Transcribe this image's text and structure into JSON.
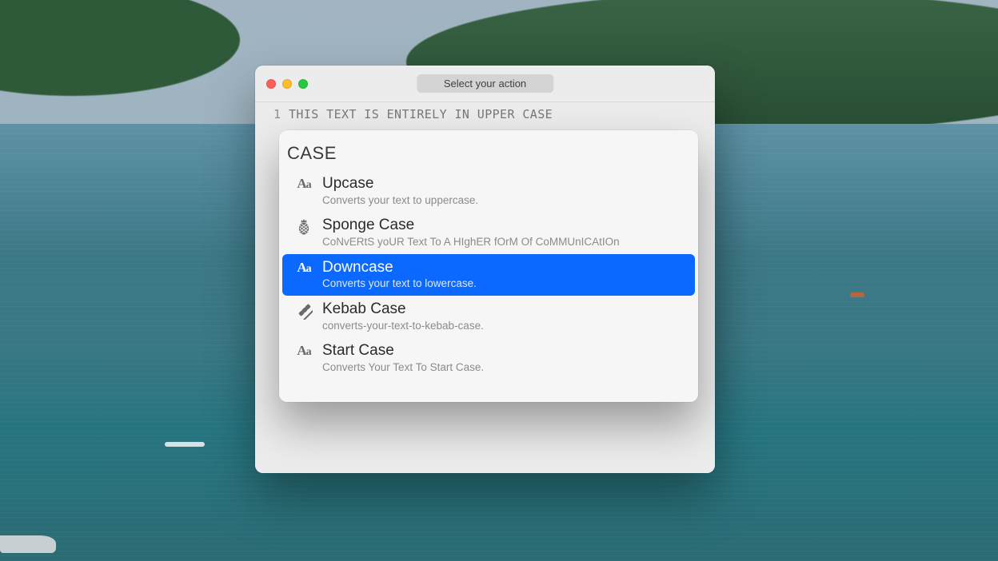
{
  "titlebar": {
    "search_placeholder": "Select your action"
  },
  "editor": {
    "line_number": "1",
    "text": "THIS TEXT IS ENTIRELY IN UPPER CASE"
  },
  "dropdown": {
    "header": "CASE",
    "options": [
      {
        "icon": "aa",
        "title": "Upcase",
        "desc": "Converts your text to uppercase.",
        "selected": false
      },
      {
        "icon": "pineapple",
        "title": "Sponge Case",
        "desc": "CoNvERtS yoUR Text To A HIghER fOrM Of CoMMUnICAtIOn",
        "selected": false
      },
      {
        "icon": "aa",
        "title": "Downcase",
        "desc": "Converts your text to lowercase.",
        "selected": true
      },
      {
        "icon": "kebab",
        "title": "Kebab Case",
        "desc": "converts-your-text-to-kebab-case.",
        "selected": false
      },
      {
        "icon": "aa",
        "title": "Start Case",
        "desc": "Converts Your Text To Start Case.",
        "selected": false
      },
      {
        "icon": "",
        "title": "",
        "desc": "",
        "selected": false,
        "clipped": true
      }
    ]
  }
}
